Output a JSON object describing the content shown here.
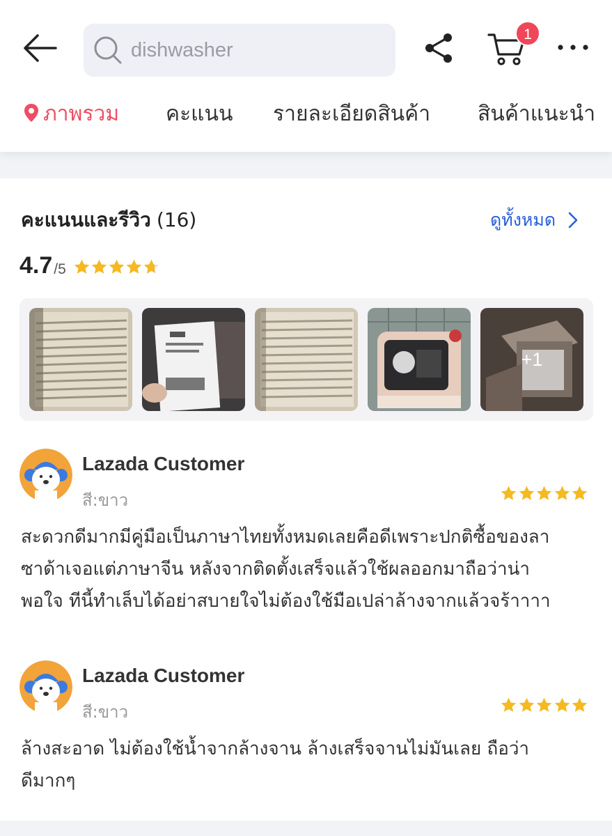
{
  "header": {
    "search": {
      "value": "",
      "placeholder": "dishwasher"
    },
    "cart_badge": "1"
  },
  "tabs": [
    {
      "label": "ภาพรวม",
      "active": true
    },
    {
      "label": "คะแนน",
      "active": false
    },
    {
      "label": "รายละเอียดสินค้า",
      "active": false
    },
    {
      "label": "สินค้าแนะนำ",
      "active": false
    }
  ],
  "reviews_section": {
    "title": "คะแนนและรีวิว",
    "count": "(16)",
    "view_all": "ดูทั้งหมด",
    "rating": "4.7",
    "rating_max": "/5",
    "stars": 4.7,
    "gallery_more": "+1"
  },
  "reviews": [
    {
      "author": "Lazada Customer",
      "variant": "สี:ขาว",
      "stars": 5,
      "lines": [
        "สะดวกดีมากมีคู่มือเป็นภาษาไทยทั้งหมดเลยคือดีเพราะปกติซื้อของลา",
        "ซาด้าเจอแต่ภาษาจีน หลังจากติดตั้งเสร็จแล้วใช้ผลออกมาถือว่าน่า",
        "พอใจ ทีนี้ทำเล็บได้อย่าสบายใจไม่ต้องใช้มือเปล่าล้างจากแล้วจร้าาาา"
      ]
    },
    {
      "author": "Lazada Customer",
      "variant": "สี:ขาว",
      "stars": 5,
      "lines": [
        "ล้างสะอาด ไม่ต้องใช้น้ำจากล้างจาน ล้างเสร็จจานไม่มันเลย ถือว่า",
        "ดีมากๆ"
      ]
    }
  ],
  "colors": {
    "accent": "#ef4d63",
    "link": "#2a5fd9",
    "star": "#f5b921",
    "badge": "#f0465a",
    "avatar_bg": "#f2a33a"
  }
}
